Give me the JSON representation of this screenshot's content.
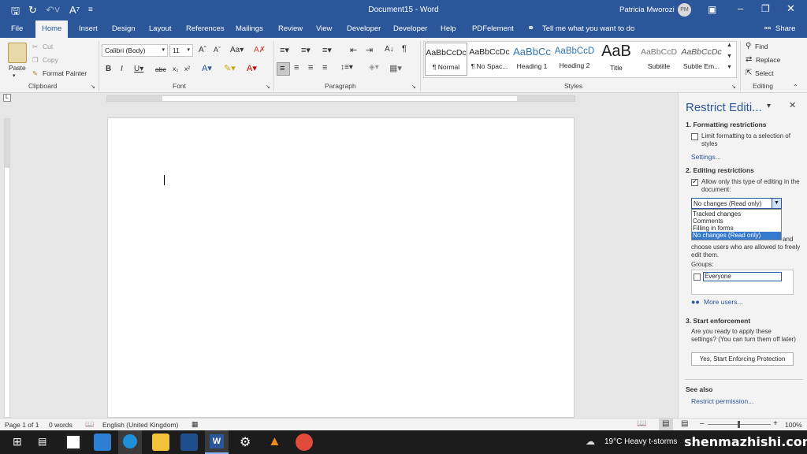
{
  "title_bar": {
    "document_title": "Document15  -  Word",
    "user_name": "Patricia Mworozi",
    "user_initials": "PM"
  },
  "tabs": [
    "File",
    "Home",
    "Insert",
    "Design",
    "Layout",
    "References",
    "Mailings",
    "Review",
    "View",
    "Developer",
    "Developer",
    "Help",
    "PDFelement"
  ],
  "tell_me": "Tell me what you want to do",
  "share": "Share",
  "clipboard": {
    "paste": "Paste",
    "cut": "Cut",
    "copy": "Copy",
    "format_painter": "Format Painter",
    "group": "Clipboard"
  },
  "font": {
    "name": "Calibri (Body)",
    "size": "11",
    "group": "Font"
  },
  "paragraph": {
    "group": "Paragraph"
  },
  "styles": {
    "group": "Styles",
    "items": [
      {
        "preview": "AaBbCcDc",
        "name": "¶ Normal"
      },
      {
        "preview": "AaBbCcDc",
        "name": "¶ No Spac..."
      },
      {
        "preview": "AaBbCc",
        "name": "Heading 1"
      },
      {
        "preview": "AaBbCcD",
        "name": "Heading 2"
      },
      {
        "preview": "AaB",
        "name": "Title"
      },
      {
        "preview": "AaBbCcD",
        "name": "Subtitle"
      },
      {
        "preview": "AaBbCcDc",
        "name": "Subtle Em..."
      }
    ]
  },
  "editing": {
    "find": "Find",
    "replace": "Replace",
    "select": "Select",
    "group": "Editing"
  },
  "pane": {
    "title": "Restrict Editi...",
    "sec1": "1. Formatting restrictions",
    "sec1_check": "Limit formatting to a selection of styles",
    "settings": "Settings...",
    "sec2": "2. Editing restrictions",
    "sec2_check": "Allow only this type of editing in the document:",
    "dropdown_value": "No changes (Read only)",
    "options": [
      "Tracked changes",
      "Comments",
      "Filling in forms",
      "No changes (Read only)"
    ],
    "exceptions_text_1": "and",
    "exceptions_text_2": "choose users who are allowed to freely edit them.",
    "groups_label": "Groups:",
    "everyone": "Everyone",
    "more_users": "More users...",
    "sec3": "3. Start enforcement",
    "sec3_text": "Are you ready to apply these settings? (You can turn them off later)",
    "start_button": "Yes, Start Enforcing Protection",
    "see_also": "See also",
    "restrict_permission": "Restrict permission..."
  },
  "status": {
    "page": "Page 1 of 1",
    "words": "0 words",
    "language": "English (United Kingdom)",
    "zoom": "100%"
  },
  "taskbar": {
    "weather": "19°C  Heavy t-storms",
    "watermark": "shenmazhishi.com"
  }
}
